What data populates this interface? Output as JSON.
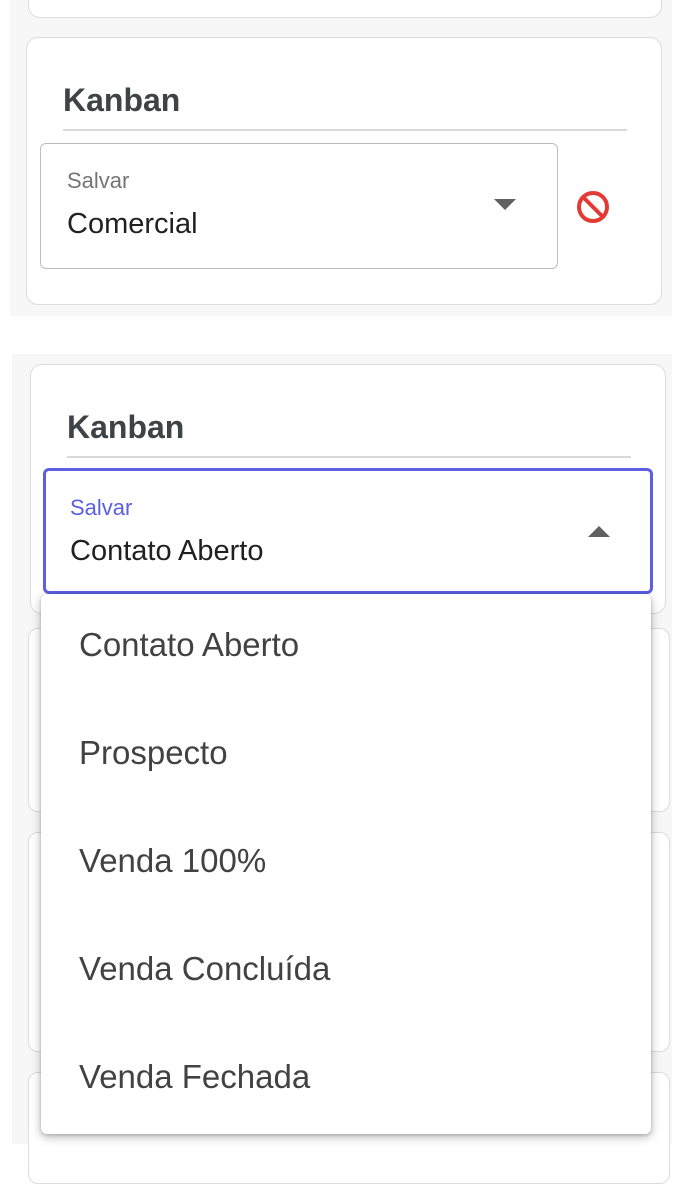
{
  "panel_top": {
    "title": "Kanban",
    "select": {
      "label": "Salvar",
      "value": "Comercial"
    },
    "clear_icon": "block-icon",
    "clear_color": "#e53935"
  },
  "panel_bottom": {
    "title": "Kanban",
    "select": {
      "label": "Salvar",
      "value": "Contato Aberto",
      "accent": "#5b5fe0"
    },
    "options": [
      "Contato Aberto",
      "Prospecto",
      "Venda 100%",
      "Venda Concluída",
      "Venda Fechada"
    ]
  }
}
